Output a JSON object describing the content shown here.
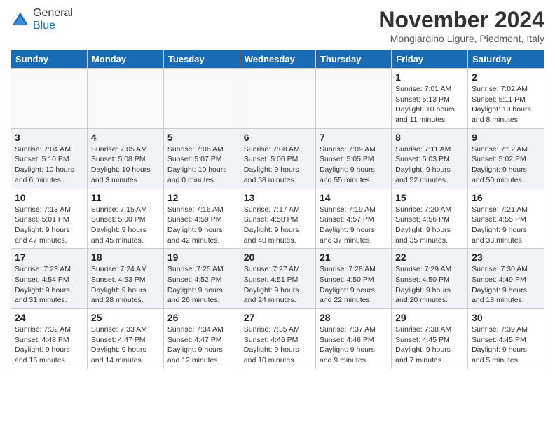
{
  "logo": {
    "general": "General",
    "blue": "Blue"
  },
  "header": {
    "title": "November 2024",
    "location": "Mongiardino Ligure, Piedmont, Italy"
  },
  "days": [
    "Sunday",
    "Monday",
    "Tuesday",
    "Wednesday",
    "Thursday",
    "Friday",
    "Saturday"
  ],
  "weeks": [
    [
      {
        "date": "",
        "info": ""
      },
      {
        "date": "",
        "info": ""
      },
      {
        "date": "",
        "info": ""
      },
      {
        "date": "",
        "info": ""
      },
      {
        "date": "",
        "info": ""
      },
      {
        "date": "1",
        "info": "Sunrise: 7:01 AM\nSunset: 5:13 PM\nDaylight: 10 hours\nand 11 minutes."
      },
      {
        "date": "2",
        "info": "Sunrise: 7:02 AM\nSunset: 5:11 PM\nDaylight: 10 hours\nand 8 minutes."
      }
    ],
    [
      {
        "date": "3",
        "info": "Sunrise: 7:04 AM\nSunset: 5:10 PM\nDaylight: 10 hours\nand 6 minutes."
      },
      {
        "date": "4",
        "info": "Sunrise: 7:05 AM\nSunset: 5:08 PM\nDaylight: 10 hours\nand 3 minutes."
      },
      {
        "date": "5",
        "info": "Sunrise: 7:06 AM\nSunset: 5:07 PM\nDaylight: 10 hours\nand 0 minutes."
      },
      {
        "date": "6",
        "info": "Sunrise: 7:08 AM\nSunset: 5:06 PM\nDaylight: 9 hours\nand 58 minutes."
      },
      {
        "date": "7",
        "info": "Sunrise: 7:09 AM\nSunset: 5:05 PM\nDaylight: 9 hours\nand 55 minutes."
      },
      {
        "date": "8",
        "info": "Sunrise: 7:11 AM\nSunset: 5:03 PM\nDaylight: 9 hours\nand 52 minutes."
      },
      {
        "date": "9",
        "info": "Sunrise: 7:12 AM\nSunset: 5:02 PM\nDaylight: 9 hours\nand 50 minutes."
      }
    ],
    [
      {
        "date": "10",
        "info": "Sunrise: 7:13 AM\nSunset: 5:01 PM\nDaylight: 9 hours\nand 47 minutes."
      },
      {
        "date": "11",
        "info": "Sunrise: 7:15 AM\nSunset: 5:00 PM\nDaylight: 9 hours\nand 45 minutes."
      },
      {
        "date": "12",
        "info": "Sunrise: 7:16 AM\nSunset: 4:59 PM\nDaylight: 9 hours\nand 42 minutes."
      },
      {
        "date": "13",
        "info": "Sunrise: 7:17 AM\nSunset: 4:58 PM\nDaylight: 9 hours\nand 40 minutes."
      },
      {
        "date": "14",
        "info": "Sunrise: 7:19 AM\nSunset: 4:57 PM\nDaylight: 9 hours\nand 37 minutes."
      },
      {
        "date": "15",
        "info": "Sunrise: 7:20 AM\nSunset: 4:56 PM\nDaylight: 9 hours\nand 35 minutes."
      },
      {
        "date": "16",
        "info": "Sunrise: 7:21 AM\nSunset: 4:55 PM\nDaylight: 9 hours\nand 33 minutes."
      }
    ],
    [
      {
        "date": "17",
        "info": "Sunrise: 7:23 AM\nSunset: 4:54 PM\nDaylight: 9 hours\nand 31 minutes."
      },
      {
        "date": "18",
        "info": "Sunrise: 7:24 AM\nSunset: 4:53 PM\nDaylight: 9 hours\nand 28 minutes."
      },
      {
        "date": "19",
        "info": "Sunrise: 7:25 AM\nSunset: 4:52 PM\nDaylight: 9 hours\nand 26 minutes."
      },
      {
        "date": "20",
        "info": "Sunrise: 7:27 AM\nSunset: 4:51 PM\nDaylight: 9 hours\nand 24 minutes."
      },
      {
        "date": "21",
        "info": "Sunrise: 7:28 AM\nSunset: 4:50 PM\nDaylight: 9 hours\nand 22 minutes."
      },
      {
        "date": "22",
        "info": "Sunrise: 7:29 AM\nSunset: 4:50 PM\nDaylight: 9 hours\nand 20 minutes."
      },
      {
        "date": "23",
        "info": "Sunrise: 7:30 AM\nSunset: 4:49 PM\nDaylight: 9 hours\nand 18 minutes."
      }
    ],
    [
      {
        "date": "24",
        "info": "Sunrise: 7:32 AM\nSunset: 4:48 PM\nDaylight: 9 hours\nand 16 minutes."
      },
      {
        "date": "25",
        "info": "Sunrise: 7:33 AM\nSunset: 4:47 PM\nDaylight: 9 hours\nand 14 minutes."
      },
      {
        "date": "26",
        "info": "Sunrise: 7:34 AM\nSunset: 4:47 PM\nDaylight: 9 hours\nand 12 minutes."
      },
      {
        "date": "27",
        "info": "Sunrise: 7:35 AM\nSunset: 4:46 PM\nDaylight: 9 hours\nand 10 minutes."
      },
      {
        "date": "28",
        "info": "Sunrise: 7:37 AM\nSunset: 4:46 PM\nDaylight: 9 hours\nand 9 minutes."
      },
      {
        "date": "29",
        "info": "Sunrise: 7:38 AM\nSunset: 4:45 PM\nDaylight: 9 hours\nand 7 minutes."
      },
      {
        "date": "30",
        "info": "Sunrise: 7:39 AM\nSunset: 4:45 PM\nDaylight: 9 hours\nand 5 minutes."
      }
    ]
  ]
}
